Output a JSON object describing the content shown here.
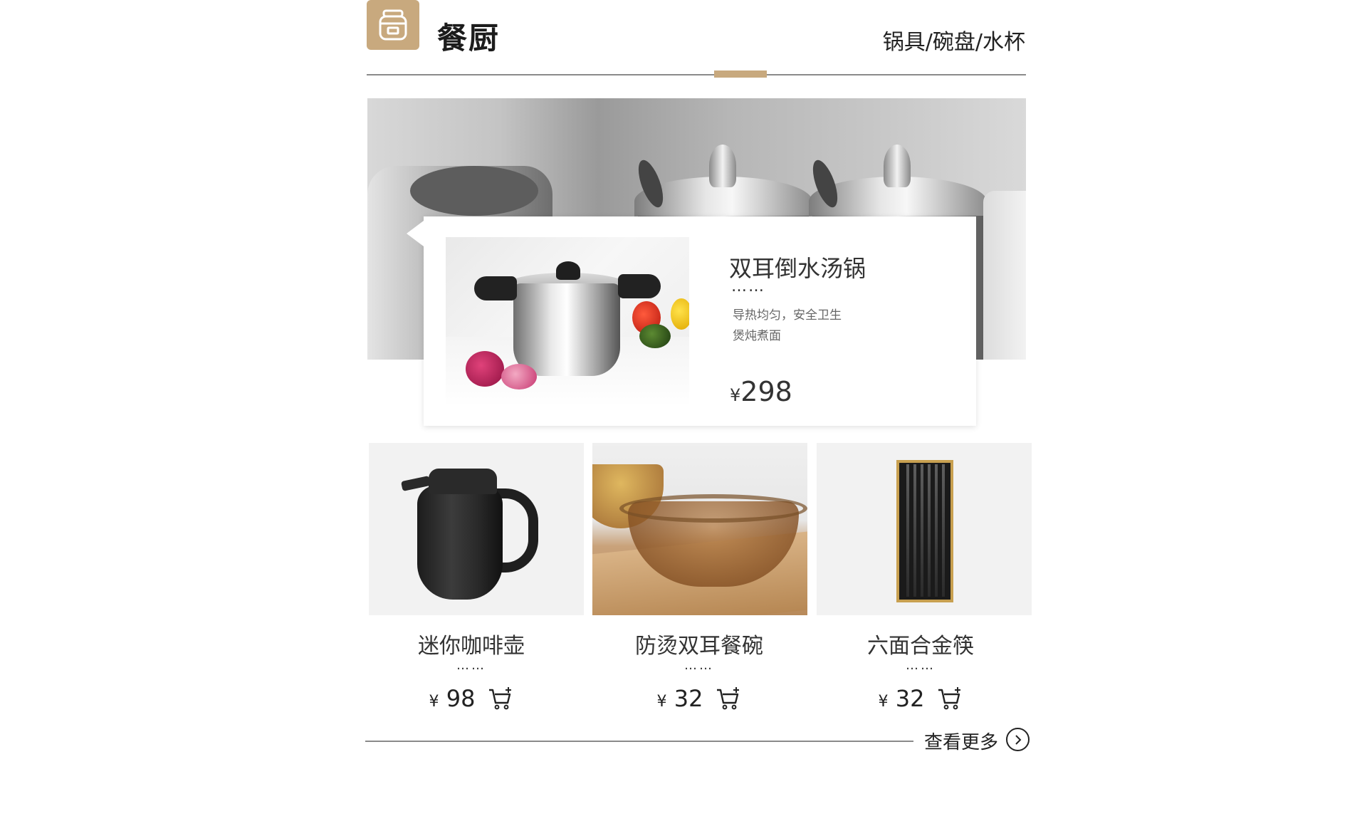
{
  "header": {
    "category_icon": "rice-cooker-icon",
    "title": "餐厨",
    "subcategories": "锅具/碗盘/水杯",
    "accent_color": "#c8a97e"
  },
  "featured": {
    "name": "双耳倒水汤锅",
    "dots": "……",
    "desc_line1": "导热均匀，安全卫生",
    "desc_line2": "煲炖煮面",
    "currency": "¥",
    "price": "298"
  },
  "products": [
    {
      "name": "迷你咖啡壶",
      "dots": "……",
      "currency": "¥",
      "price": "98",
      "cart_icon": "cart-add-icon"
    },
    {
      "name": "防烫双耳餐碗",
      "dots": "……",
      "currency": "¥",
      "price": "32",
      "cart_icon": "cart-add-icon"
    },
    {
      "name": "六面合金筷",
      "dots": "……",
      "currency": "¥",
      "price": "32",
      "cart_icon": "cart-add-icon"
    }
  ],
  "footer": {
    "more_label": "查看更多",
    "more_icon": "chevron-right-circle-icon"
  }
}
